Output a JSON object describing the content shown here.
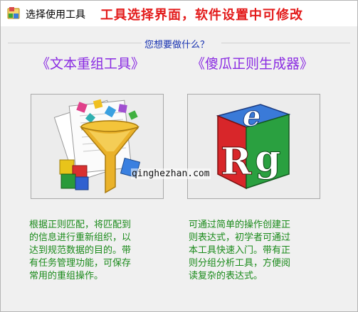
{
  "window": {
    "title": "选择使用工具",
    "title_note": "工具选择界面，软件设置中可修改"
  },
  "prompt": {
    "question": "您想要做什么？"
  },
  "options": [
    {
      "title": "《文本重组工具》",
      "icon": "funnel-puzzle-icon",
      "description_lines": [
        "根据正则匹配，将匹配到",
        "的信息进行重新组织，以",
        "达到规范数据的目的。带",
        "有任务管理功能，可保存",
        "常用的重组操作。"
      ]
    },
    {
      "title": "《傻瓜正则生成器》",
      "icon": "reg-cube-icon",
      "description_lines": [
        "可通过简单的操作创建正",
        "则表达式，初学者可通过",
        "本工具快速入门。带有正",
        "则分组分析工具，方便阅",
        "读复杂的表达式。"
      ]
    }
  ],
  "watermark": "qinghezhan.com",
  "colors": {
    "title_note": "#e31b1b",
    "question": "#1530b0",
    "option_title": "#8a2be2",
    "description": "#1a8a1a"
  }
}
